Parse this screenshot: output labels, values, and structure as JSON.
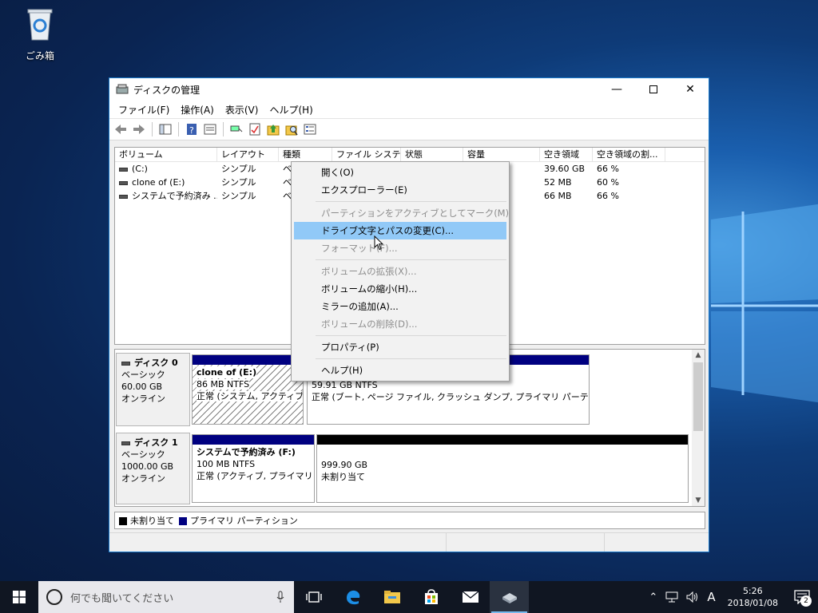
{
  "desktop": {
    "recycle_bin_label": "ごみ箱"
  },
  "window": {
    "title": "ディスクの管理",
    "controls": [
      "minimize-icon",
      "maximize-icon",
      "close-icon"
    ]
  },
  "menubar": [
    "ファイル(F)",
    "操作(A)",
    "表示(V)",
    "ヘルプ(H)"
  ],
  "toolbar": [
    "back-icon",
    "forward-icon",
    "show-hide-tree-icon",
    "help-icon",
    "properties-icon",
    "connect-icon",
    "check-icon",
    "up-folder-icon",
    "search-folder-icon",
    "list-icon"
  ],
  "volume_table": {
    "columns": [
      "ボリューム",
      "レイアウト",
      "種類",
      "ファイル システム",
      "状態",
      "容量",
      "空き領域",
      "空き領域の割..."
    ],
    "rows": [
      {
        "volume": "(C:)",
        "layout": "シンプル",
        "type": "ベ",
        "free": "39.60 GB",
        "free_pct": "66 %"
      },
      {
        "volume": "clone of  (E:)",
        "layout": "シンプル",
        "type": "ベ",
        "free": "52 MB",
        "free_pct": "60 %"
      },
      {
        "volume": "システムで予約済み ...",
        "layout": "シンプル",
        "type": "ベ",
        "free": "66 MB",
        "free_pct": "66 %"
      }
    ]
  },
  "context_menu": {
    "items": [
      {
        "label": "開く(O)",
        "enabled": true
      },
      {
        "label": "エクスプローラー(E)",
        "enabled": true
      },
      {
        "label": "パーティションをアクティブとしてマーク(M)",
        "enabled": false
      },
      {
        "label": "ドライブ文字とパスの変更(C)...",
        "enabled": true,
        "highlighted": true
      },
      {
        "label": "フォーマット(F)...",
        "enabled": false
      },
      {
        "label": "ボリュームの拡張(X)...",
        "enabled": false
      },
      {
        "label": "ボリュームの縮小(H)...",
        "enabled": true
      },
      {
        "label": "ミラーの追加(A)...",
        "enabled": true
      },
      {
        "label": "ボリュームの削除(D)...",
        "enabled": false
      },
      {
        "label": "プロパティ(P)",
        "enabled": true
      },
      {
        "label": "ヘルプ(H)",
        "enabled": true
      }
    ]
  },
  "disks": [
    {
      "name": "ディスク 0",
      "type": "ベーシック",
      "size": "60.00 GB",
      "status": "オンライン",
      "partitions": [
        {
          "title": "clone of   (E:)",
          "size": "86 MB NTFS",
          "state": "正常 (システム, アクティブ, プ"
        },
        {
          "title": "",
          "size": "59.91 GB NTFS",
          "state": "正常 (ブート, ページ ファイル, クラッシュ ダンプ, プライマリ パーティション)"
        }
      ]
    },
    {
      "name": "ディスク 1",
      "type": "ベーシック",
      "size": "1000.00 GB",
      "status": "オンライン",
      "partitions": [
        {
          "title": "システムで予約済み  (F:)",
          "size": "100 MB NTFS",
          "state": "正常 (アクティブ, プライマリ パー"
        },
        {
          "title": "",
          "size": "999.90 GB",
          "state": "未割り当て"
        }
      ]
    }
  ],
  "legend": [
    {
      "label": "未割り当て",
      "color": "#000000"
    },
    {
      "label": "プライマリ パーティション",
      "color": "#000080"
    }
  ],
  "taskbar": {
    "search_placeholder": "何でも聞いてください",
    "apps": [
      "task-view-icon",
      "edge-icon",
      "file-explorer-icon",
      "store-icon",
      "mail-icon",
      "disk-management-icon"
    ],
    "ime": "A",
    "time": "5:26",
    "date": "2018/01/08",
    "notification_count": "2"
  },
  "colors": {
    "accent": "#1979ca",
    "menu_highlight": "#91c9f7",
    "primary_partition": "#000080"
  }
}
